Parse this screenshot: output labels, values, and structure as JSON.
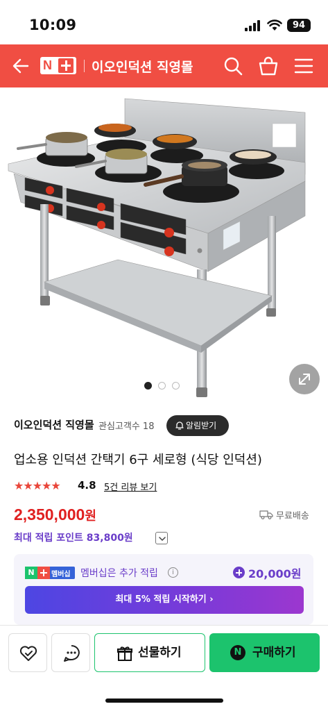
{
  "status_bar": {
    "time": "10:09",
    "battery": "94"
  },
  "header": {
    "logo_n": "N",
    "title": "이오인덕션 직영몰"
  },
  "product": {
    "image_alt": "6-burner stainless induction cooktop",
    "carousel": {
      "count": 3,
      "active": 1
    }
  },
  "store": {
    "name": "이오인덕션 직영몰",
    "followers": "관심고객수 18",
    "alert_button": "알림받기"
  },
  "title": "업소용 인덕션 간택기 6구 세로형 (식당 인덕션)",
  "rating": {
    "stars": "★★★★★",
    "score": "4.8",
    "reviews_link": "5건 리뷰 보기"
  },
  "price": {
    "amount": "2,350,000",
    "unit": "원"
  },
  "shipping": "무료배송",
  "points": "최대 적립 포인트 83,800원",
  "membership": {
    "badge_n": "N",
    "badge_text": "멤버십",
    "text": "멤버십은 추가 적립",
    "info": "i",
    "amount": "20,000원",
    "cta": "최대 5% 적립 시작하기 ›"
  },
  "bottom": {
    "gift_label": "선물하기",
    "buy_label": "구매하기",
    "buy_n": "N"
  },
  "colors": {
    "header_red": "#f04e43",
    "price_red": "#e02020",
    "naver_green": "#1cc36d",
    "purple": "#6a3dc9"
  }
}
